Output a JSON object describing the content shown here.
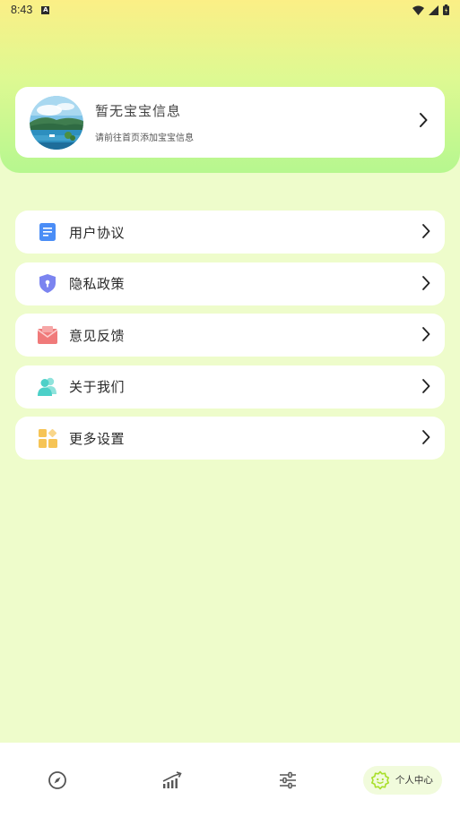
{
  "status_bar": {
    "time": "8:43",
    "notification_icon": "a-letter-icon",
    "right_icons": [
      "wifi-icon",
      "cell-signal-icon",
      "battery-icon"
    ]
  },
  "profile": {
    "title": "暂无宝宝信息",
    "subtitle": "请前往首页添加宝宝信息",
    "avatar": "avatar-landscape-image"
  },
  "menu": {
    "items": [
      {
        "label": "用户协议",
        "icon": "document-icon",
        "color": "#4a8df6"
      },
      {
        "label": "隐私政策",
        "icon": "shield-icon",
        "color": "#7b84f0"
      },
      {
        "label": "意见反馈",
        "icon": "envelope-icon",
        "color": "#f07a7a"
      },
      {
        "label": "关于我们",
        "icon": "users-icon",
        "color": "#4cd0c8"
      },
      {
        "label": "更多设置",
        "icon": "grid-icon",
        "color": "#f6c455"
      }
    ]
  },
  "tab_bar": {
    "tabs": [
      {
        "icon": "compass-icon"
      },
      {
        "icon": "growth-chart-icon"
      },
      {
        "icon": "sliders-icon"
      },
      {
        "icon": "baby-face-icon",
        "label": "个人中心",
        "active": true
      }
    ]
  },
  "colors": {
    "page_bg": "#eefccb",
    "header_gradient_top": "#fbef86",
    "header_gradient_bottom": "#b6f78f",
    "accent": "#a8df2a"
  }
}
